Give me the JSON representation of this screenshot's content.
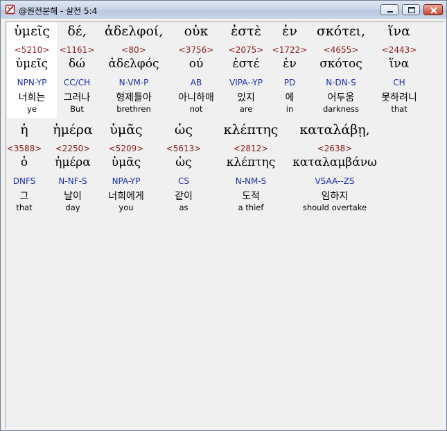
{
  "window": {
    "title": "@원전분해 - 살전 5:4",
    "icon": "verse-app-icon"
  },
  "rows": [
    {
      "words": [
        {
          "greek": "ὑμεῖς",
          "number": "<5210>",
          "lemma": "ὑμεῖς",
          "parsing": "NPN-YP",
          "korean": "너희는",
          "english": "ye"
        },
        {
          "greek": "δέ,",
          "number": "<1161>",
          "lemma": "δώ",
          "parsing": "CC/CH",
          "korean": "그러나",
          "english": "But"
        },
        {
          "greek": "ἀδελφοί,",
          "number": "<80>",
          "lemma": "ἀδελφός",
          "parsing": "N-VM-P",
          "korean": "형제들아",
          "english": "brethren"
        },
        {
          "greek": "οὐκ",
          "number": "<3756>",
          "lemma": "ού",
          "parsing": "AB",
          "korean": "아니하매",
          "english": "not"
        },
        {
          "greek": "ἐστὲ",
          "number": "<2075>",
          "lemma": "ἐστέ",
          "parsing": "VIPA--YP",
          "korean": "있지",
          "english": "are"
        },
        {
          "greek": "ἐν",
          "number": "<1722>",
          "lemma": "ἐν",
          "parsing": "PD",
          "korean": "에",
          "english": "in"
        },
        {
          "greek": "σκότει,",
          "number": "<4655>",
          "lemma": "σκότος",
          "parsing": "N-DN-S",
          "korean": "어두움",
          "english": "darkness"
        },
        {
          "greek": "ἵνα",
          "number": "<2443>",
          "lemma": "ἵνα",
          "parsing": "CH",
          "korean": "못하려니",
          "english": "that"
        }
      ]
    },
    {
      "words": [
        {
          "greek": "ἡ",
          "number": "<3588>",
          "lemma": "ὁ",
          "parsing": "DNFS",
          "korean": "그",
          "english": "that"
        },
        {
          "greek": "ἡμέρα",
          "number": "<2250>",
          "lemma": "ἡμέρα",
          "parsing": "N-NF-S",
          "korean": "날이",
          "english": "day"
        },
        {
          "greek": "ὑμᾶς",
          "number": "<5209>",
          "lemma": "ὑμᾶς",
          "parsing": "NPA-YP",
          "korean": "너희에게",
          "english": "you"
        },
        {
          "greek": "ὡς",
          "number": "<5613>",
          "lemma": "ὡς",
          "parsing": "CS",
          "korean": "같이",
          "english": "as"
        },
        {
          "greek": "κλέπτης",
          "number": "<2812>",
          "lemma": "κλέπτης",
          "parsing": "N-NM-S",
          "korean": "도적",
          "english": "a thief"
        },
        {
          "greek": "καταλάβῃ,",
          "number": "<2638>",
          "lemma": "καταλαμβάνω",
          "parsing": "VSAA--ZS",
          "korean": "임하지",
          "english": "should overtake"
        }
      ]
    }
  ]
}
